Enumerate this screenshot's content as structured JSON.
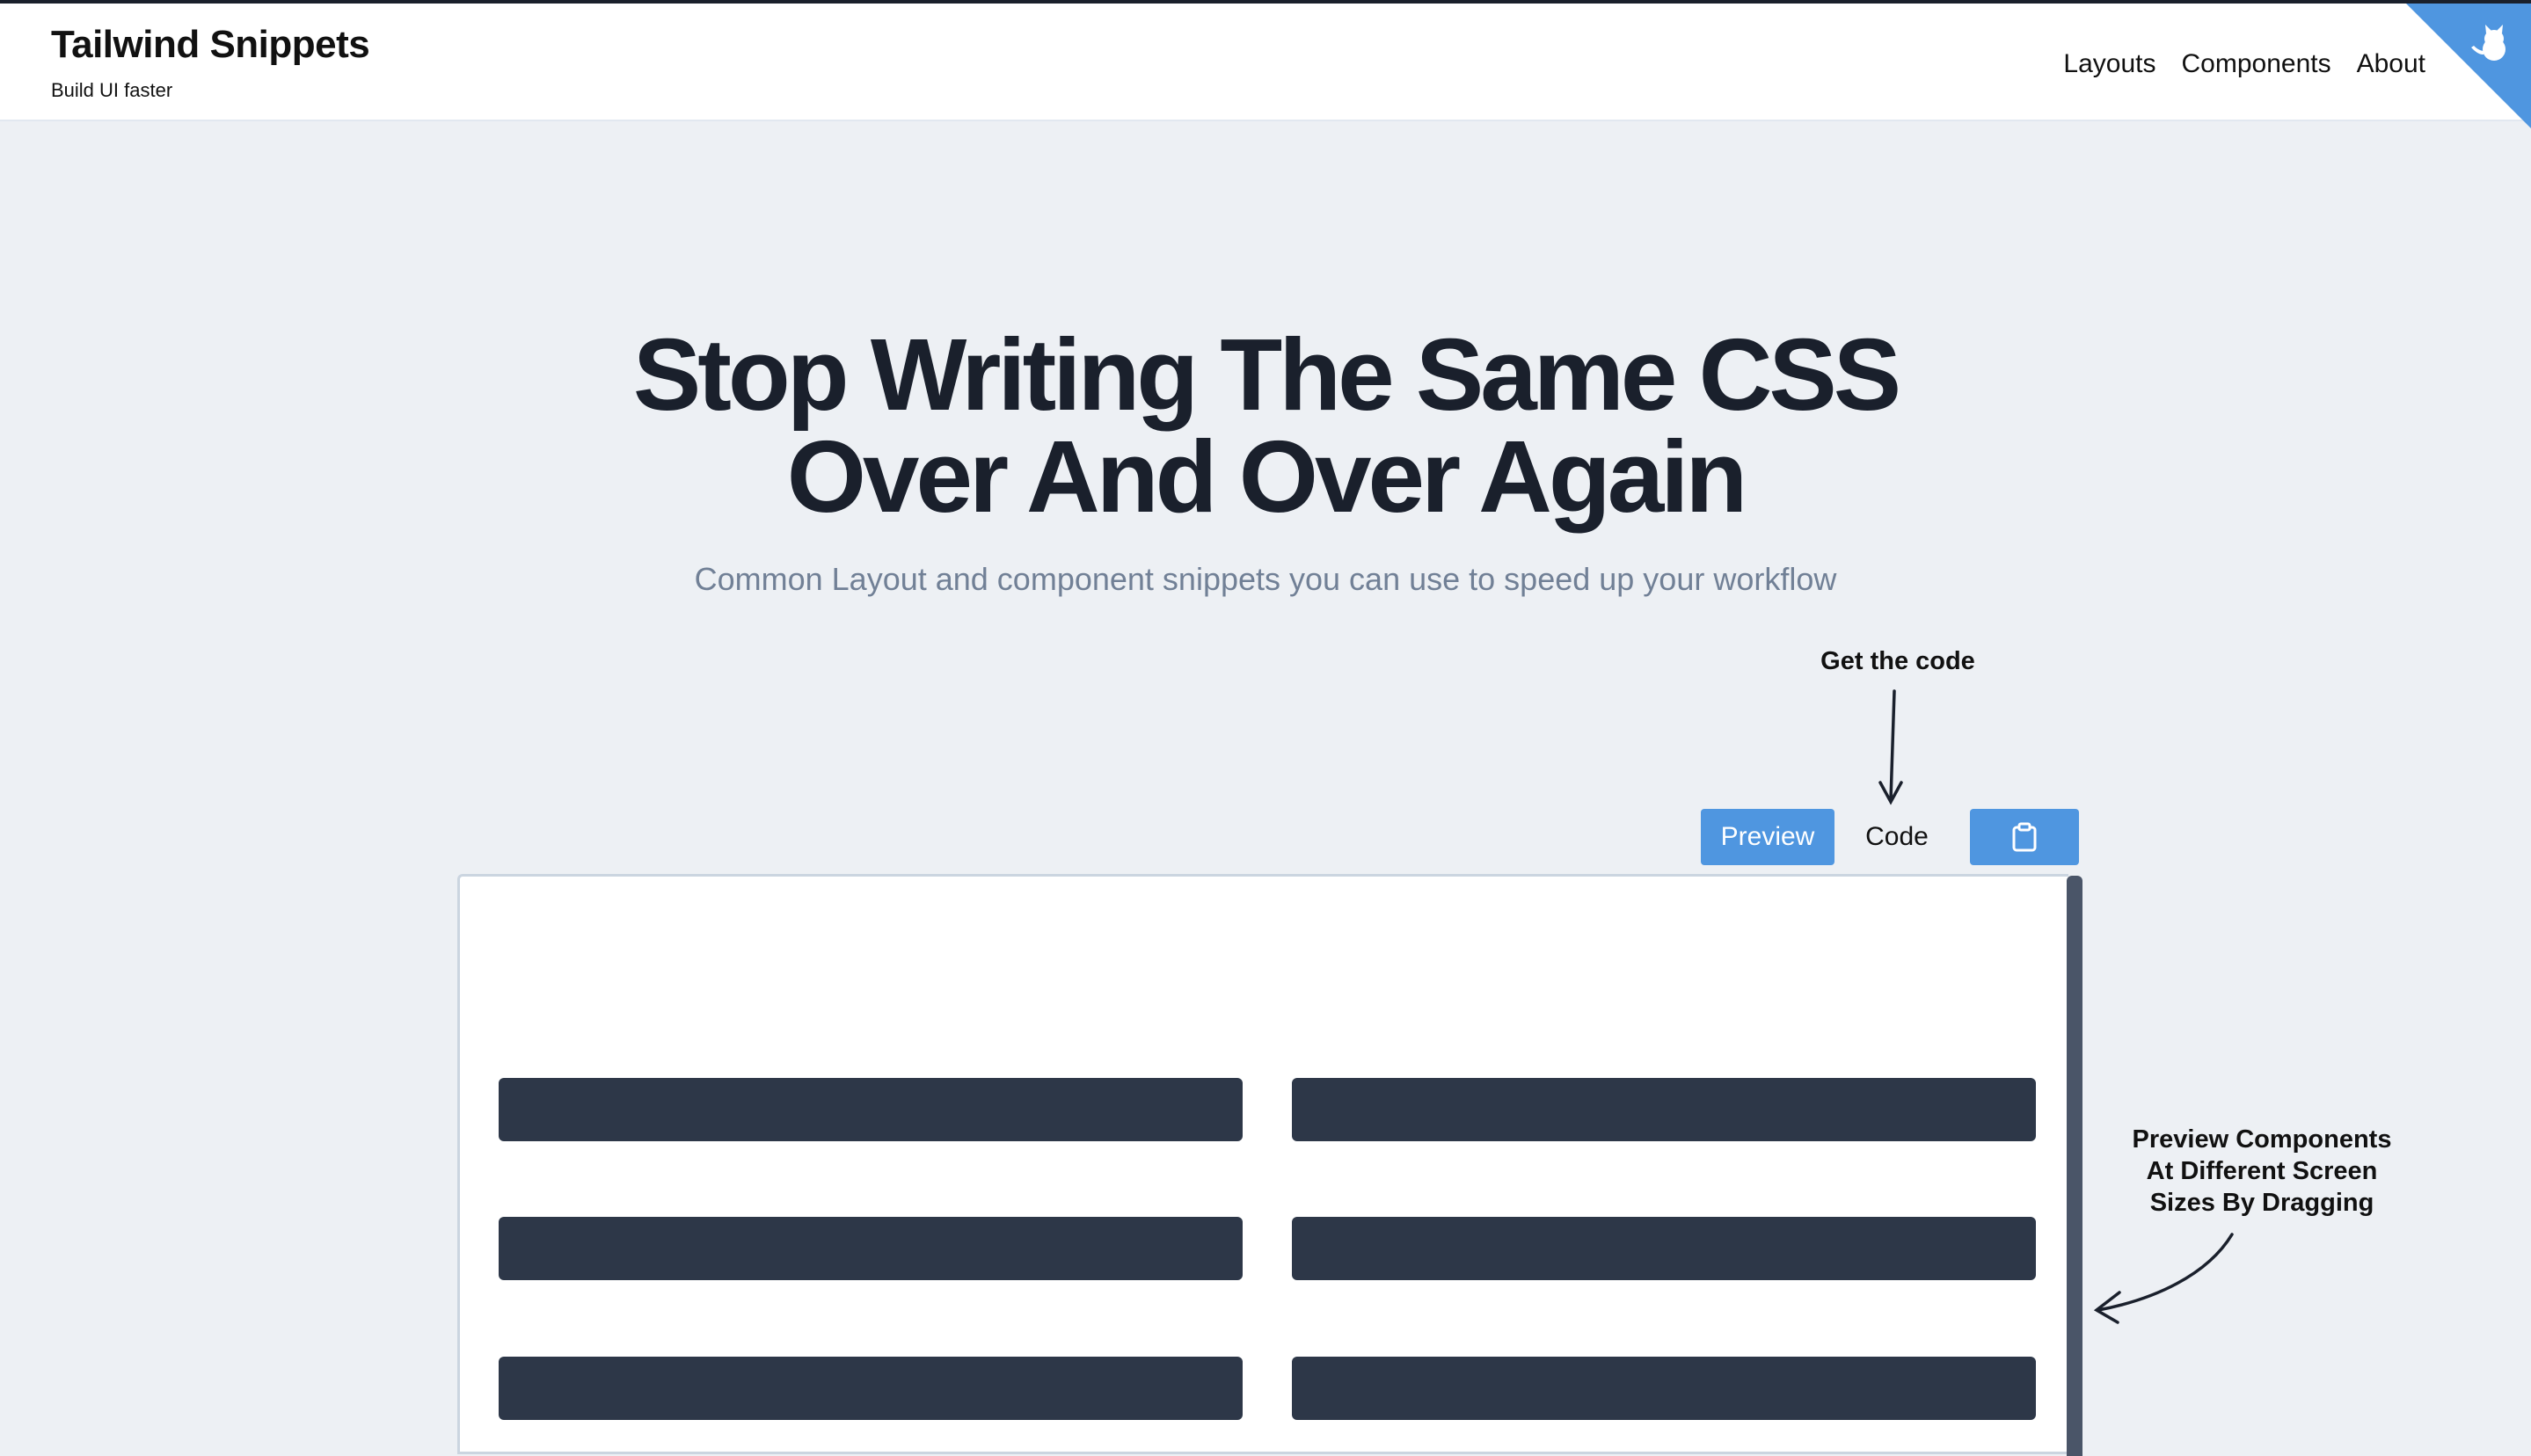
{
  "header": {
    "title": "Tailwind Snippets",
    "subtitle": "Build UI faster",
    "nav": [
      "Layouts",
      "Components",
      "About"
    ],
    "corner_icon": "github-octocat-icon"
  },
  "hero": {
    "title_line1": "Stop Writing The Same CSS",
    "title_line2": "Over And Over Again",
    "subtitle": "Common Layout and component snippets you can use to speed up your workflow"
  },
  "annotations": {
    "code_hint": "Get the code",
    "preview_hint_line1": "Preview Components",
    "preview_hint_line2": "At Different Screen",
    "preview_hint_line3": "Sizes By Dragging"
  },
  "toolbar": {
    "preview_label": "Preview",
    "code_label": "Code",
    "copy_icon": "clipboard-icon"
  },
  "preview": {
    "columns": 2,
    "rows_visible": 3
  },
  "colors": {
    "accent": "#4f96e0",
    "background": "#edf0f4",
    "dark": "#2d3748",
    "handle": "#4a5568"
  }
}
